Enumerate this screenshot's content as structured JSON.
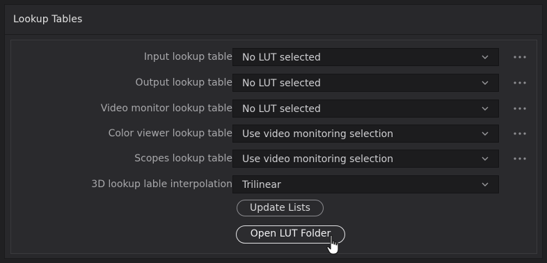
{
  "panel": {
    "title": "Lookup Tables"
  },
  "rows": [
    {
      "label": "Input lookup table",
      "value": "No LUT selected",
      "has_more": true
    },
    {
      "label": "Output lookup table",
      "value": "No LUT selected",
      "has_more": true
    },
    {
      "label": "Video monitor lookup table",
      "value": "No LUT selected",
      "has_more": true
    },
    {
      "label": "Color viewer lookup table",
      "value": "Use video monitoring selection",
      "has_more": true
    },
    {
      "label": "Scopes lookup table",
      "value": "Use video monitoring selection",
      "has_more": true
    },
    {
      "label": "3D lookup lable interpolation",
      "value": "Trilinear",
      "has_more": false
    }
  ],
  "buttons": {
    "update_lists": "Update Lists",
    "open_lut_folder": "Open LUT Folder"
  },
  "icons": {
    "dropdown": "chevron-down-icon",
    "more": "more-options-icon",
    "cursor": "hand-pointer-cursor"
  },
  "colors": {
    "background": "#202022",
    "panel": "#28282b",
    "dropdown_bg": "#1c1c1e",
    "label_text": "#a8a8ab",
    "value_text": "#cfcfd2"
  }
}
